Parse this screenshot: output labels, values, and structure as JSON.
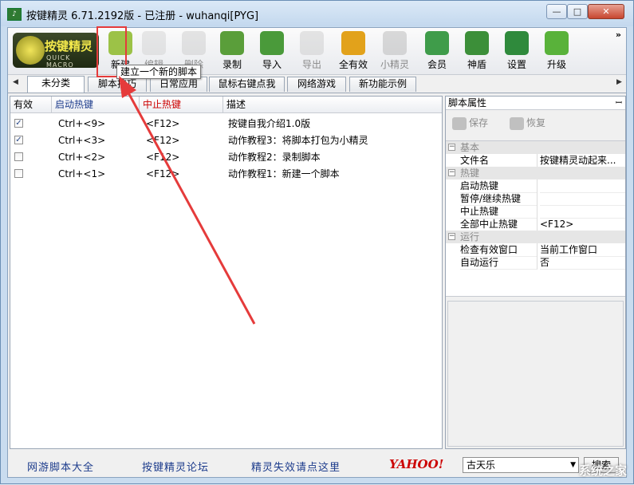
{
  "window": {
    "title": "按键精灵 6.71.2192版 - 已注册 - wuhanqi[PYG]"
  },
  "logo": {
    "text_main": "按键精灵",
    "text_sub": "QUICK MACRO"
  },
  "toolbar": {
    "items": [
      {
        "label": "新建",
        "icon": "new-script-icon",
        "color": "#9cc247"
      },
      {
        "label": "编辑",
        "icon": "edit-icon",
        "color": "#cfcfcf",
        "disabled": true
      },
      {
        "label": "删除",
        "icon": "trash-icon",
        "color": "#c8c8c8",
        "disabled": true
      },
      {
        "label": "录制",
        "icon": "camcorder-icon",
        "color": "#5a9e3a"
      },
      {
        "label": "导入",
        "icon": "import-icon",
        "color": "#4a9a3a"
      },
      {
        "label": "导出",
        "icon": "export-icon",
        "color": "#c8c8c8",
        "disabled": true
      },
      {
        "label": "全有效",
        "icon": "all-valid-icon",
        "color": "#e2a21b"
      },
      {
        "label": "小精灵",
        "icon": "sprite-icon",
        "color": "#b0b0b0",
        "disabled": true
      },
      {
        "label": "会员",
        "icon": "member-icon",
        "color": "#3f9c4a"
      },
      {
        "label": "神盾",
        "icon": "shield-icon",
        "color": "#3c8f39"
      },
      {
        "label": "设置",
        "icon": "gear-icon",
        "color": "#2f8a3c"
      },
      {
        "label": "升级",
        "icon": "upgrade-icon",
        "color": "#59b23a"
      }
    ],
    "more": "»"
  },
  "tooltip": "建立一个新的脚本",
  "tabs": [
    "未分类",
    "脚本技巧",
    "日常应用",
    "鼠标右键点我",
    "网络游戏",
    "新功能示例"
  ],
  "list": {
    "columns": [
      "有效",
      "启动热键",
      "中止热键",
      "描述"
    ],
    "rows": [
      {
        "checked": true,
        "start": "Ctrl+<9>",
        "stop": "<F12>",
        "desc": "按键自我介绍1.0版"
      },
      {
        "checked": true,
        "start": "Ctrl+<3>",
        "stop": "<F12>",
        "desc": "动作教程3：将脚本打包为小精灵"
      },
      {
        "checked": false,
        "start": "Ctrl+<2>",
        "stop": "<F12>",
        "desc": "动作教程2：录制脚本"
      },
      {
        "checked": false,
        "start": "Ctrl+<1>",
        "stop": "<F12>",
        "desc": "动作教程1：新建一个脚本"
      }
    ]
  },
  "props": {
    "title": "脚本属性",
    "save": "保存",
    "restore": "恢复",
    "groups": [
      {
        "name": "基本",
        "rows": [
          {
            "k": "文件名",
            "v": "按键精灵动起来..."
          }
        ]
      },
      {
        "name": "热键",
        "rows": [
          {
            "k": "启动热键",
            "v": ""
          },
          {
            "k": "暂停/继续热键",
            "v": ""
          },
          {
            "k": "中止热键",
            "v": ""
          },
          {
            "k": "全部中止热键",
            "v": "<F12>"
          }
        ]
      },
      {
        "name": "运行",
        "rows": [
          {
            "k": "检查有效窗口",
            "v": "当前工作窗口"
          },
          {
            "k": "自动运行",
            "v": "否"
          }
        ]
      }
    ]
  },
  "bottom": {
    "links": [
      "网游脚本大全",
      "按键精灵论坛",
      "精灵失效请点这里"
    ],
    "yahoo": "YAHOO!",
    "search_value": "古天乐",
    "search_button": "搜索"
  },
  "watermark": "系统之家"
}
